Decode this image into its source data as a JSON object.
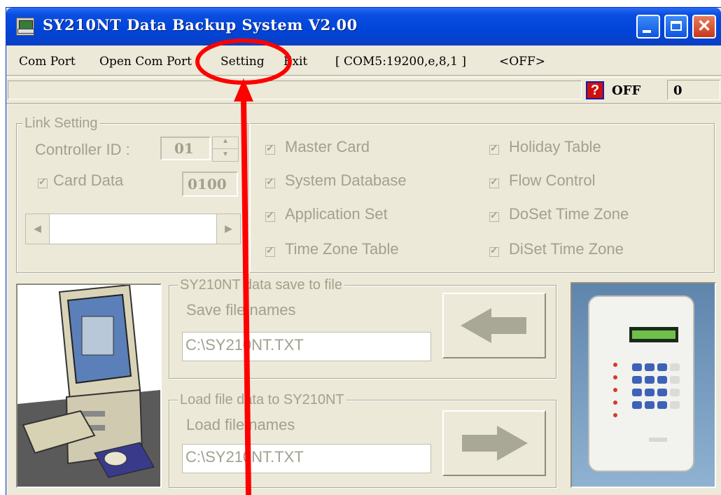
{
  "window": {
    "title": "SY210NT Data Backup System V2.00",
    "controls": {
      "minimize_icon": "minimize-icon",
      "maximize_icon": "maximize-icon",
      "close_icon": "close-icon"
    }
  },
  "menu": {
    "items": [
      "Com Port",
      "Open Com Port",
      "Setting",
      "Exit"
    ],
    "port_status": "[ COM5:19200,e,8,1 ]",
    "off_tag": "<OFF>"
  },
  "status": {
    "help_icon": "question-icon",
    "state": "OFF",
    "count": "0"
  },
  "link_setting": {
    "legend": "Link Setting",
    "controller_id_label": "Controller ID :",
    "controller_id_value": "01",
    "card_data_label": "Card Data",
    "card_data_value": "0100"
  },
  "options": {
    "left": [
      "Master Card",
      "System Database",
      "Application Set",
      "Time Zone Table"
    ],
    "right": [
      "Holiday Table",
      "Flow Control",
      "DoSet Time Zone",
      "DiSet Time Zone"
    ]
  },
  "save_group": {
    "legend": "SY210NT data save to file",
    "label": "Save file names",
    "path": "C:\\SY210NT.TXT"
  },
  "load_group": {
    "legend": "Load file data to SY210NT",
    "label": "Load file names",
    "path": "C:\\SY210NT.TXT"
  },
  "colors": {
    "title_blue": "#0045d8",
    "window_bg": "#ece9d8",
    "disabled_text": "#a2a08f",
    "annotation_red": "#ff0000"
  }
}
